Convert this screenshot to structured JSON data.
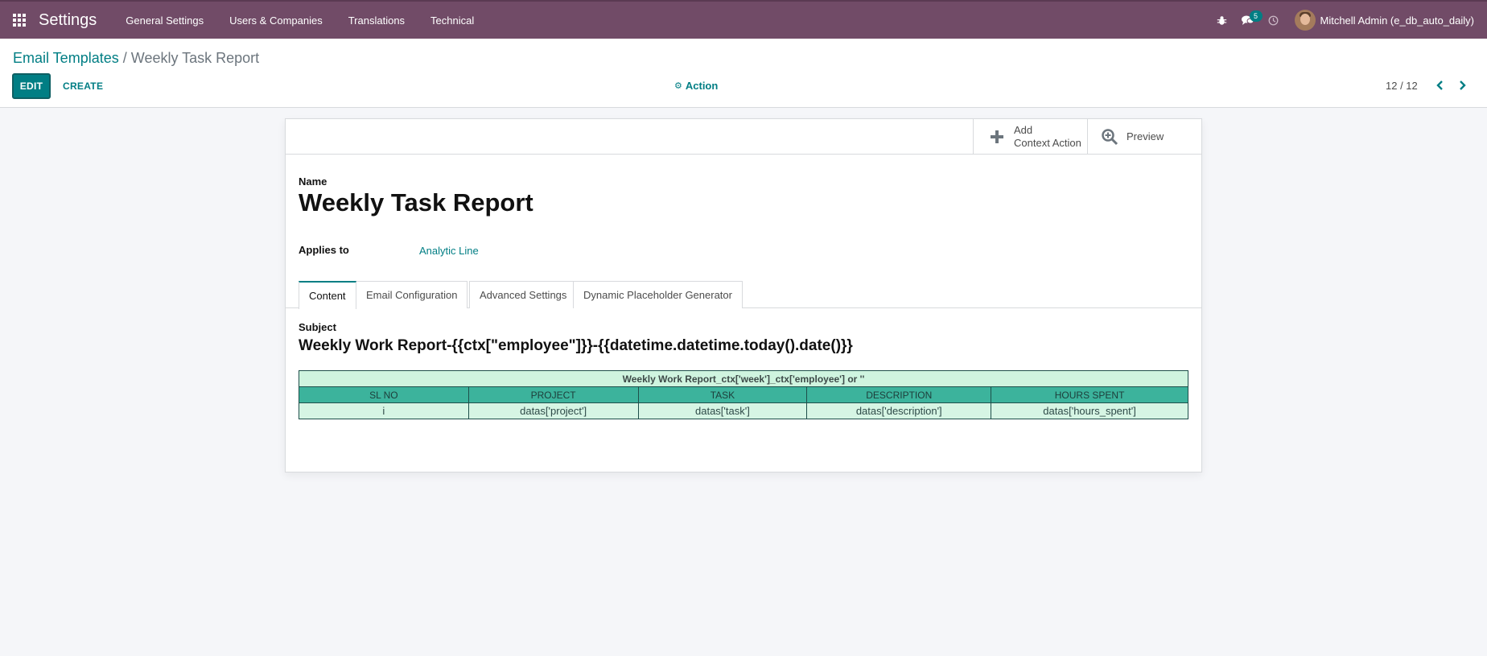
{
  "navbar": {
    "brand": "Settings",
    "menus": [
      "General Settings",
      "Users & Companies",
      "Translations",
      "Technical"
    ],
    "messages_count": "5",
    "user_name": "Mitchell Admin (e_db_auto_daily)",
    "bg_color": "#714b67"
  },
  "control_panel": {
    "breadcrumb_parent": "Email Templates",
    "breadcrumb_separator": "/",
    "breadcrumb_current": "Weekly Task Report",
    "edit_label": "EDIT",
    "create_label": "CREATE",
    "action_label": "Action",
    "pager_value": "12 / 12"
  },
  "button_box": {
    "context_action_line1": "Add",
    "context_action_line2": "Context Action",
    "preview_label": "Preview"
  },
  "form": {
    "name_label": "Name",
    "name_value": "Weekly Task Report",
    "applies_label": "Applies to",
    "applies_value": "Analytic Line",
    "tabs": [
      "Content",
      "Email Configuration",
      "Advanced Settings",
      "Dynamic Placeholder Generator"
    ],
    "active_tab": "Content",
    "subject_label": "Subject",
    "subject_value": "Weekly Work Report-{{ctx[\"employee\"]}}-{{datetime.datetime.today().date()}}"
  },
  "body_table": {
    "caption": "Weekly Work Report_ctx['week']_ctx['employee'] or ''",
    "headers": [
      "SL NO",
      "PROJECT",
      "TASK",
      "DESCRIPTION",
      "HOURS SPENT"
    ],
    "row": [
      "i",
      "datas['project']",
      "datas['task']",
      "datas['description']",
      "datas['hours_spent']"
    ]
  },
  "colors": {
    "accent": "#017e84",
    "table_header": "#3cb39c",
    "table_body": "#d6f5e4"
  }
}
